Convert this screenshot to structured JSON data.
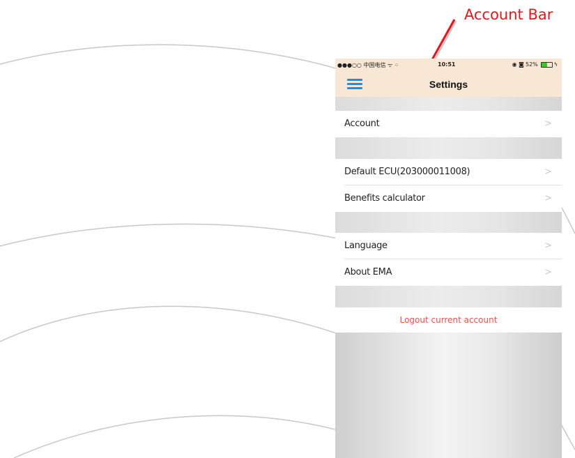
{
  "callout": {
    "label": "Account Bar",
    "color": "#e8141c"
  },
  "status_bar": {
    "signal_carrier": "●●●○○ 中国电信 ᯤ ⁘",
    "time": "10:51",
    "indicators": "◉ ◙",
    "battery_percent": "52%",
    "battery_level": 0.52,
    "battery_color": "#39c535"
  },
  "nav": {
    "menu_icon": "hamburger-menu-icon",
    "title": "Settings",
    "background": "#f9e7d6",
    "accent": "#1d8fe0"
  },
  "settings": {
    "account": "Account",
    "default_ecu": "Default ECU(203000011008)",
    "benefits_calculator": "Benefits calculator",
    "language": "Language",
    "about": "About EMA",
    "chevron": ">",
    "logout": "Logout current account",
    "logout_color": "#e5534b"
  }
}
